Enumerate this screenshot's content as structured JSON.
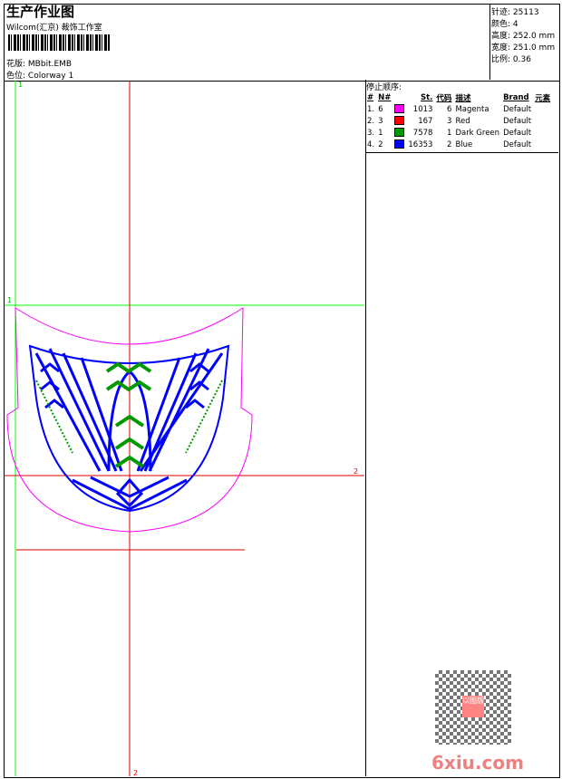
{
  "header": {
    "title": "生产作业图",
    "company": "Wilcom(汇京) 裁饰工作室",
    "design_label": "花版:",
    "design_value": "MBbit.EMB",
    "colorway_label": "色位:",
    "colorway_value": "Colorway 1"
  },
  "info": [
    {
      "label": "针迹:",
      "value": "25113"
    },
    {
      "label": "颜色:",
      "value": "4"
    },
    {
      "label": "高度:",
      "value": "252.0 mm"
    },
    {
      "label": "宽度:",
      "value": "251.0 mm"
    },
    {
      "label": "比例:",
      "value": "0.36"
    }
  ],
  "stop_sequence": {
    "title": "停止顺序:",
    "columns": [
      "#",
      "N#",
      "St.",
      "代码",
      "描述",
      "Brand",
      "元素"
    ],
    "rows": [
      {
        "idx": "1.",
        "n": "6",
        "color": "#ff00ff",
        "st": "1013",
        "code": "6",
        "desc": "Magenta",
        "brand": "Default"
      },
      {
        "idx": "2.",
        "n": "3",
        "color": "#ff0000",
        "st": "167",
        "code": "3",
        "desc": "Red",
        "brand": "Default"
      },
      {
        "idx": "3.",
        "n": "1",
        "color": "#009900",
        "st": "7578",
        "code": "1",
        "desc": "Dark Green",
        "brand": "Default"
      },
      {
        "idx": "4.",
        "n": "2",
        "color": "#0000ff",
        "st": "16353",
        "code": "2",
        "desc": "Blue",
        "brand": "Default"
      }
    ]
  },
  "guides": {
    "green_label_top": "1",
    "green_label_left": "1",
    "red_label_right": "2",
    "red_label_bottom": "2"
  },
  "watermark": {
    "text": "6xiu.com",
    "stamp": "以图版"
  }
}
